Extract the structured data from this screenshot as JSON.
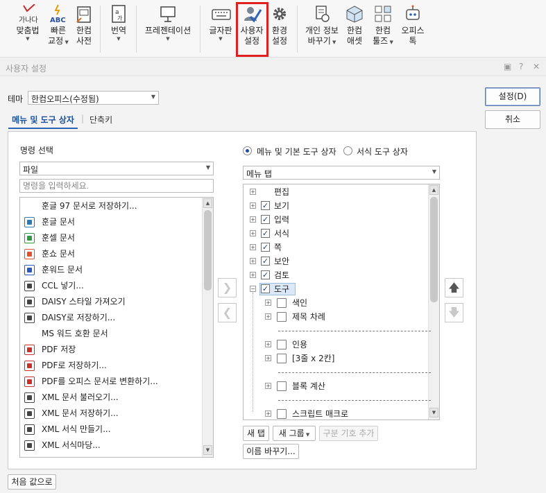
{
  "ribbon": {
    "items": [
      {
        "id": "fit",
        "line1": "맞춤법",
        "line2": "",
        "dropdown": true,
        "icon": "spellcheck-icon",
        "glyph": "가나다"
      },
      {
        "id": "quick",
        "line1": "빠른",
        "line2": "교정",
        "dropdown": true,
        "icon": "quick-correct-icon",
        "glyph": "ABC"
      },
      {
        "id": "dict",
        "line1": "한컴",
        "line2": "사전",
        "dropdown": false,
        "icon": "dictionary-icon"
      },
      {
        "id": "translate",
        "line1": "번역",
        "line2": "",
        "dropdown": true,
        "icon": "translate-icon"
      },
      {
        "id": "present",
        "line1": "프레젠테이션",
        "line2": "",
        "dropdown": true,
        "icon": "presentation-icon"
      },
      {
        "id": "keyboard",
        "line1": "글자판",
        "line2": "",
        "dropdown": true,
        "icon": "keyboard-icon"
      },
      {
        "id": "usersettings",
        "line1": "사용자",
        "line2": "설정",
        "dropdown": false,
        "icon": "user-settings-icon"
      },
      {
        "id": "env",
        "line1": "환경",
        "line2": "설정",
        "dropdown": false,
        "icon": "gear-icon"
      },
      {
        "id": "privacy",
        "line1": "개인 정보",
        "line2": "바꾸기",
        "dropdown": true,
        "icon": "privacy-icon"
      },
      {
        "id": "assets",
        "line1": "한컴",
        "line2": "애셋",
        "dropdown": false,
        "icon": "asset-icon"
      },
      {
        "id": "tools",
        "line1": "한컴",
        "line2": "툴즈",
        "dropdown": true,
        "icon": "tools-icon"
      },
      {
        "id": "office",
        "line1": "오피스",
        "line2": "톡",
        "dropdown": false,
        "icon": "bot-icon"
      }
    ]
  },
  "dialog": {
    "title": "사용자 설정",
    "controls": [
      "▣",
      "?",
      "✕"
    ],
    "theme_label": "테마",
    "theme_value": "한컴오피스(수정됨)",
    "ok_label": "설정(D)",
    "cancel_label": "취소",
    "reset_label": "처음 값으로",
    "tabs": [
      {
        "label": "메뉴 및 도구 상자",
        "active": true
      },
      {
        "label": "단축키",
        "active": false
      }
    ],
    "tab_divider": "|"
  },
  "left": {
    "title": "명령 선택",
    "category": "파일",
    "search_placeholder": "명령을 입력하세요.",
    "commands": [
      {
        "label": "훈글 97 문서로 저장하기...",
        "icon": "none"
      },
      {
        "label": "훈글 문서",
        "icon": "hwp-doc-icon",
        "color": "#2a7ab8"
      },
      {
        "label": "훈셀 문서",
        "icon": "hcell-doc-icon",
        "color": "#2d9a45"
      },
      {
        "label": "훈쇼 문서",
        "icon": "hshow-doc-icon",
        "color": "#e0532a"
      },
      {
        "label": "훈워드 문서",
        "icon": "hword-doc-icon",
        "color": "#2a5ab8"
      },
      {
        "label": "CCL 넣기...",
        "icon": "ccl-icon",
        "color": "#444"
      },
      {
        "label": "DAISY 스타일 가져오기",
        "icon": "daisy-style-icon",
        "color": "#444"
      },
      {
        "label": "DAISY로 저장하기...",
        "icon": "daisy-save-icon",
        "color": "#444"
      },
      {
        "label": "MS 워드 호환 문서",
        "icon": "none"
      },
      {
        "label": "PDF 저장",
        "icon": "pdf-icon",
        "color": "#c8302a"
      },
      {
        "label": "PDF로 저장하기...",
        "icon": "pdf-save-icon",
        "color": "#c8302a"
      },
      {
        "label": "PDF를 오피스 문서로 변환하기...",
        "icon": "pdf-convert-icon",
        "color": "#c8302a"
      },
      {
        "label": "XML 문서 불러오기...",
        "icon": "xml-open-icon",
        "color": "#444"
      },
      {
        "label": "XML 문서 저장하기...",
        "icon": "xml-save-icon",
        "color": "#444"
      },
      {
        "label": "XML 서식 만들기...",
        "icon": "xml-format-icon",
        "color": "#444"
      },
      {
        "label": "XML 서식마당...",
        "icon": "xml-template-icon",
        "color": "#444"
      }
    ]
  },
  "right": {
    "radio_menu": "메뉴 및 기본 도구 상자",
    "radio_format": "서식 도구 상자",
    "tab_combo": "메뉴 탭",
    "tree": [
      {
        "label": "편집",
        "checked": false,
        "level": 0,
        "expander": "+"
      },
      {
        "label": "보기",
        "checked": true,
        "level": 0,
        "expander": "+"
      },
      {
        "label": "입력",
        "checked": true,
        "level": 0,
        "expander": "+"
      },
      {
        "label": "서식",
        "checked": true,
        "level": 0,
        "expander": "+"
      },
      {
        "label": "쪽",
        "checked": true,
        "level": 0,
        "expander": "+"
      },
      {
        "label": "보안",
        "checked": true,
        "level": 0,
        "expander": "+"
      },
      {
        "label": "검토",
        "checked": true,
        "level": 0,
        "expander": "+"
      },
      {
        "label": "도구",
        "checked": true,
        "level": 0,
        "expander": "−",
        "selected": true
      },
      {
        "label": "색인",
        "level": 1,
        "expander": "+",
        "icon": "index-icon"
      },
      {
        "label": "제목 차례",
        "level": 1,
        "expander": "+",
        "icon": "toc-icon"
      },
      {
        "label": "",
        "level": 1,
        "separator": true
      },
      {
        "label": "인용",
        "level": 1,
        "expander": "+",
        "icon": "citation-icon"
      },
      {
        "label": "[3줄 x 2칸]",
        "level": 1,
        "expander": "+",
        "icon": "grid-icon"
      },
      {
        "label": "",
        "level": 1,
        "separator": true
      },
      {
        "label": "블록 계산",
        "level": 1,
        "expander": "+",
        "icon": "block-calc-icon"
      },
      {
        "label": "",
        "level": 1,
        "separator": true
      },
      {
        "label": "스크립트 매크로",
        "level": 1,
        "expander": "+",
        "icon": "script-macro-icon"
      }
    ],
    "new_tab": "새 탭",
    "new_group": "새 그룹",
    "separator_add": "구분 기호 추가",
    "rename": "이름 바꾸기..."
  }
}
